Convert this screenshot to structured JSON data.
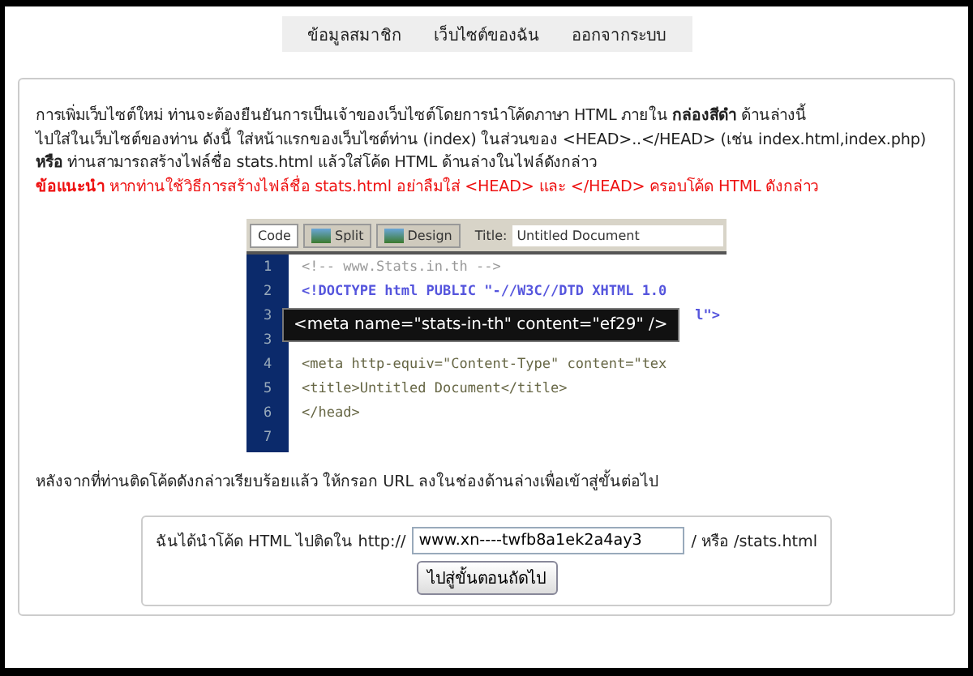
{
  "nav": [
    {
      "label": "ข้อมูลสมาชิก"
    },
    {
      "label": "เว็บไซต์ของฉัน"
    },
    {
      "label": "ออกจากระบบ"
    }
  ],
  "instructions": [
    {
      "kind": "normal",
      "text": "การเพิ่มเว็บไซต์ใหม่ ท่านจะต้องยืนยันการเป็นเจ้าของเว็บไซต์โดยการนำโค้ดภาษา HTML ภายใน **กล่องสีดำ** ด้านล่างนี้"
    },
    {
      "kind": "normal",
      "text": "ไปใส่ในเว็บไซต์ของท่าน ดังนี้ ใส่หน้าแรกของเว็บไซต์ท่าน (index) ในส่วนของ <HEAD>..</HEAD> (เช่น index.html,index.php)"
    },
    {
      "kind": "normal",
      "text": "**หรือ** ท่านสามารถสร้างไฟล์ชื่อ stats.html แล้วใส่โค้ด HTML ด้านล่างในไฟล์ดังกล่าว"
    },
    {
      "kind": "warning",
      "text": "**ข้อแนะนำ** หากท่านใช้วิธีการสร้างไฟล์ชื่อ stats.html อย่าลืมใส่ <HEAD> และ </HEAD> ครอบโค้ด HTML ดังกล่าว"
    }
  ],
  "editor": {
    "tabs": [
      {
        "label": "Code",
        "selected": true
      },
      {
        "label": "Split",
        "selected": false
      },
      {
        "label": "Design",
        "selected": false
      }
    ],
    "title_label": "Title:",
    "title_value": "Untitled Document",
    "lines": [
      {
        "number": "1",
        "code": "<!-- www.Stats.in.th -->",
        "kind": "comment"
      },
      {
        "number": "2",
        "code": "<!DOCTYPE html PUBLIC \"-//W3C//DTD XHTML 1.0",
        "kind": "doctype"
      },
      {
        "number": "3",
        "code": "l\">",
        "kind": "tail"
      },
      {
        "number": "3"
      },
      {
        "number": "4",
        "code": "<meta http-equiv=\"Content-Type\" content=\"tex",
        "kind": "tag"
      },
      {
        "number": "5",
        "code": "<title>Untitled Document</title>",
        "kind": "tag"
      },
      {
        "number": "6",
        "code": "</head>",
        "kind": "tag"
      },
      {
        "number": "7"
      }
    ],
    "meta_code": "<meta name=\"stats-in-th\" content=\"ef29\" />"
  },
  "after_text": "หลังจากที่ท่านติดโค้ดดังกล่าวเรียบร้อยแล้ว ให้กรอก URL ลงในช่องด้านล่างเพื่อเข้าสู่ขั้นต่อไป",
  "form": {
    "label": "ฉันได้นำโค้ด HTML ไปติดใน http://",
    "url": "www.xn----twfb8a1ek2a4ay3",
    "suffix": "/ หรือ /stats.html",
    "button": "ไปสู่ขั้นตอนถัดไป"
  }
}
